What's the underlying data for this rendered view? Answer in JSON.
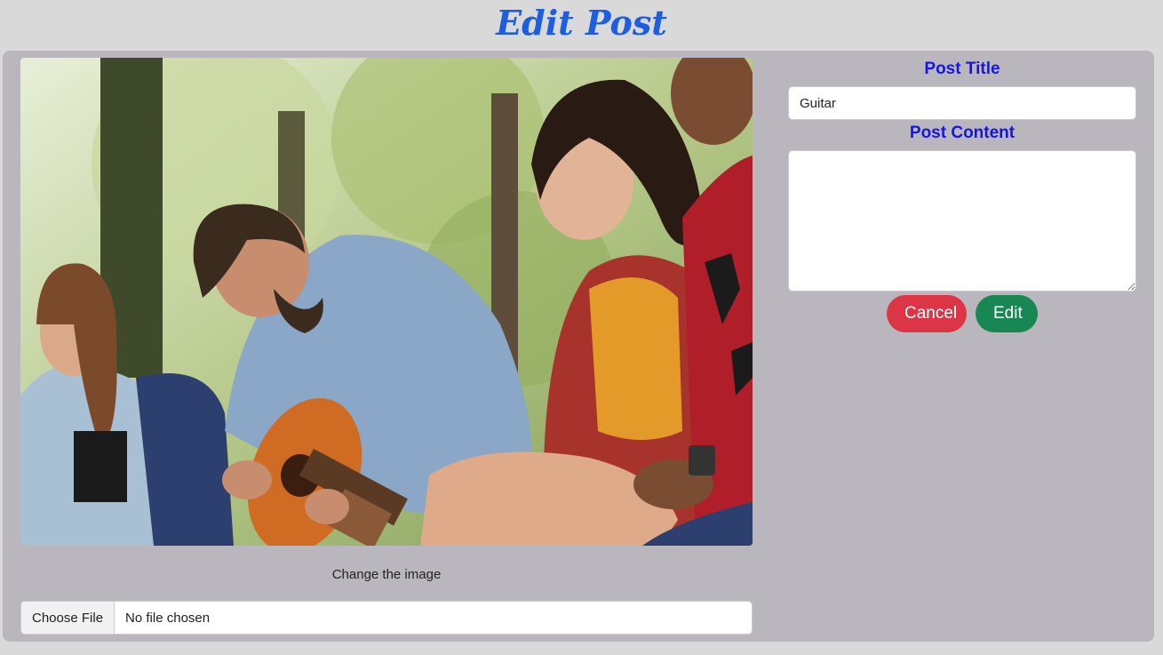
{
  "page": {
    "title": "Edit Post"
  },
  "image_section": {
    "change_label": "Change the image",
    "file_button": "Choose File",
    "file_status": "No file chosen"
  },
  "form": {
    "title_label": "Post Title",
    "title_value": "Guitar",
    "content_label": "Post Content",
    "content_value": "",
    "cancel_label": "Cancel",
    "edit_label": "Edit"
  },
  "colors": {
    "page_title": "#1d5ee0",
    "form_label": "#1515e6",
    "cancel": "#dc3545",
    "edit": "#198754",
    "panel": "#b9b7bd",
    "background": "#d9d9d9"
  }
}
